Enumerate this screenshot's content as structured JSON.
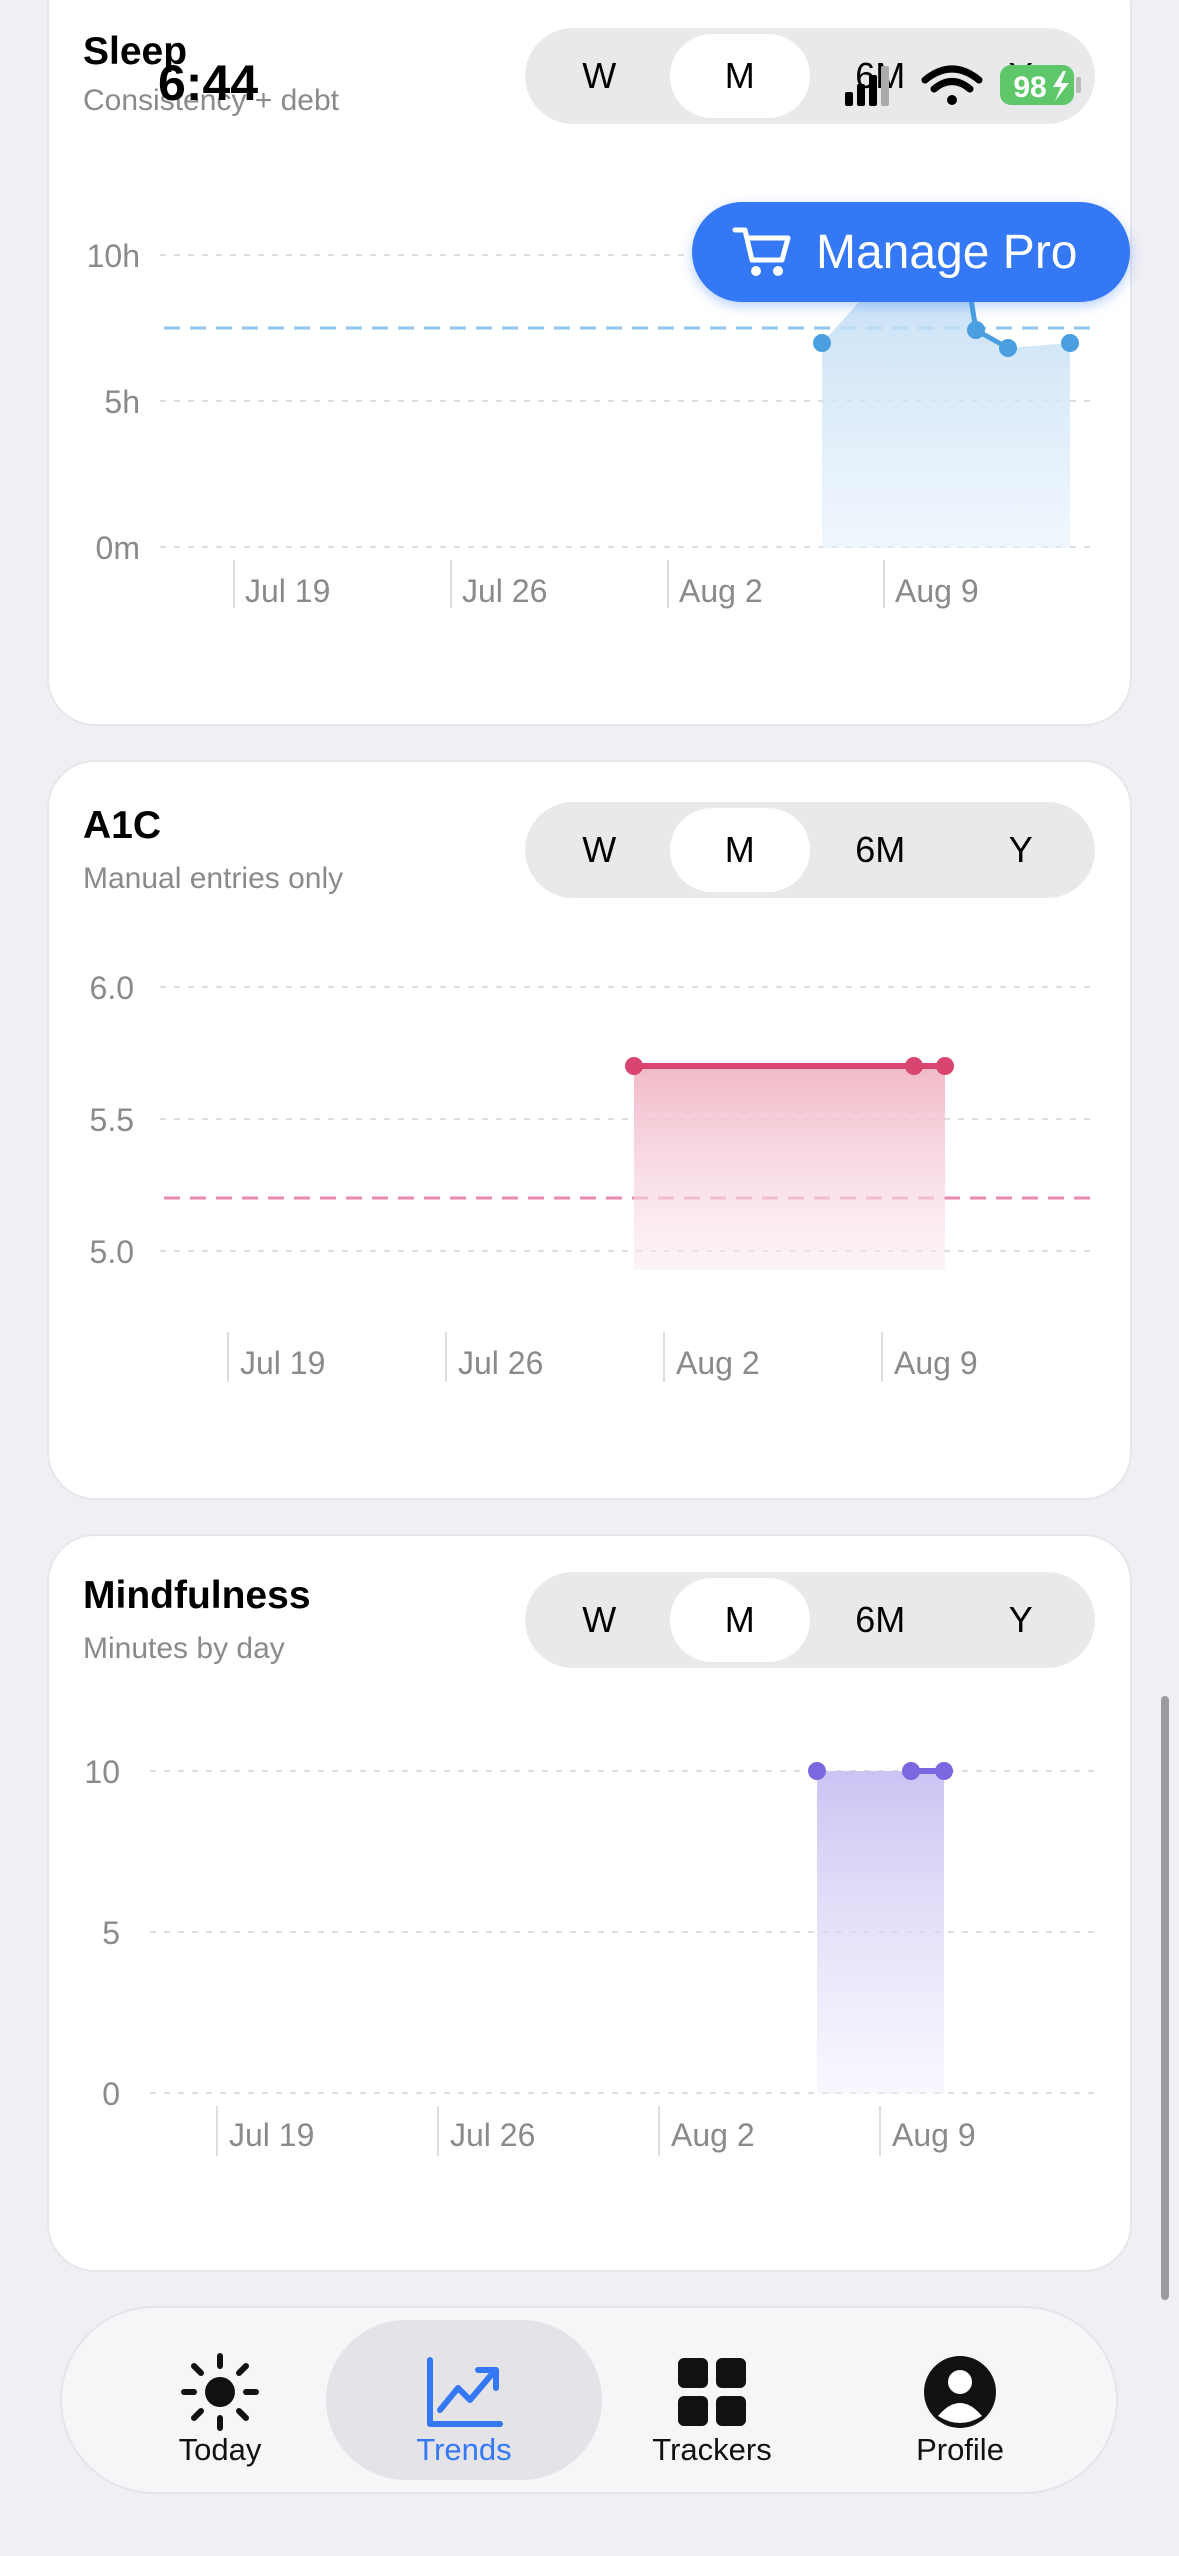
{
  "status_bar": {
    "time": "6:44",
    "battery": "98"
  },
  "manage_pro": {
    "label": "Manage Pro"
  },
  "segment_options": [
    "W",
    "M",
    "6M",
    "Y"
  ],
  "cards": {
    "sleep": {
      "title": "Sleep",
      "subtitle": "Consistency + debt",
      "selected_range": "M"
    },
    "a1c": {
      "title": "A1C",
      "subtitle": "Manual entries only",
      "selected_range": "M"
    },
    "mindfulness": {
      "title": "Mindfulness",
      "subtitle": "Minutes by day",
      "selected_range": "M"
    }
  },
  "chart_data": [
    {
      "type": "area",
      "title": "Sleep",
      "ylabel": "",
      "y_ticks": [
        "10h",
        "5h",
        "0m"
      ],
      "ylim": [
        0,
        10
      ],
      "x_ticks": [
        "Jul 19",
        "Jul 26",
        "Aug 2",
        "Aug 9"
      ],
      "target_line": 7.5,
      "series": [
        {
          "x": [
            "Aug 7",
            "Aug 8",
            "Aug 9",
            "Aug 10",
            "Aug 11",
            "Aug 12",
            "Aug 13",
            "Aug 14"
          ],
          "values": [
            7.0,
            7.8,
            9.2,
            9.4,
            9.1,
            7.5,
            6.9,
            7.0
          ]
        }
      ],
      "color": "#4a9fe0"
    },
    {
      "type": "area",
      "title": "A1C",
      "ylabel": "",
      "y_ticks": [
        "6.0",
        "5.5",
        "5.0"
      ],
      "ylim": [
        4.7,
        6.0
      ],
      "x_ticks": [
        "Jul 19",
        "Jul 26",
        "Aug 2",
        "Aug 9"
      ],
      "target_line": 5.2,
      "series": [
        {
          "x": [
            "Jul 31",
            "Aug 9",
            "Aug 10"
          ],
          "values": [
            5.7,
            5.7,
            5.7
          ]
        }
      ],
      "color": "#d9456e"
    },
    {
      "type": "area",
      "title": "Mindfulness",
      "ylabel": "",
      "y_ticks": [
        "10",
        "5",
        "0"
      ],
      "ylim": [
        0,
        10
      ],
      "x_ticks": [
        "Jul 19",
        "Jul 26",
        "Aug 2",
        "Aug 9"
      ],
      "series": [
        {
          "x": [
            "Aug 6",
            "Aug 9",
            "Aug 10"
          ],
          "values": [
            10,
            10,
            10
          ]
        }
      ],
      "color": "#7b68e0"
    }
  ],
  "tabbar": {
    "items": [
      {
        "label": "Today",
        "icon": "sun-icon"
      },
      {
        "label": "Trends",
        "icon": "trend-chart-icon",
        "active": true
      },
      {
        "label": "Trackers",
        "icon": "grid-icon"
      },
      {
        "label": "Profile",
        "icon": "person-circle-icon"
      }
    ]
  }
}
